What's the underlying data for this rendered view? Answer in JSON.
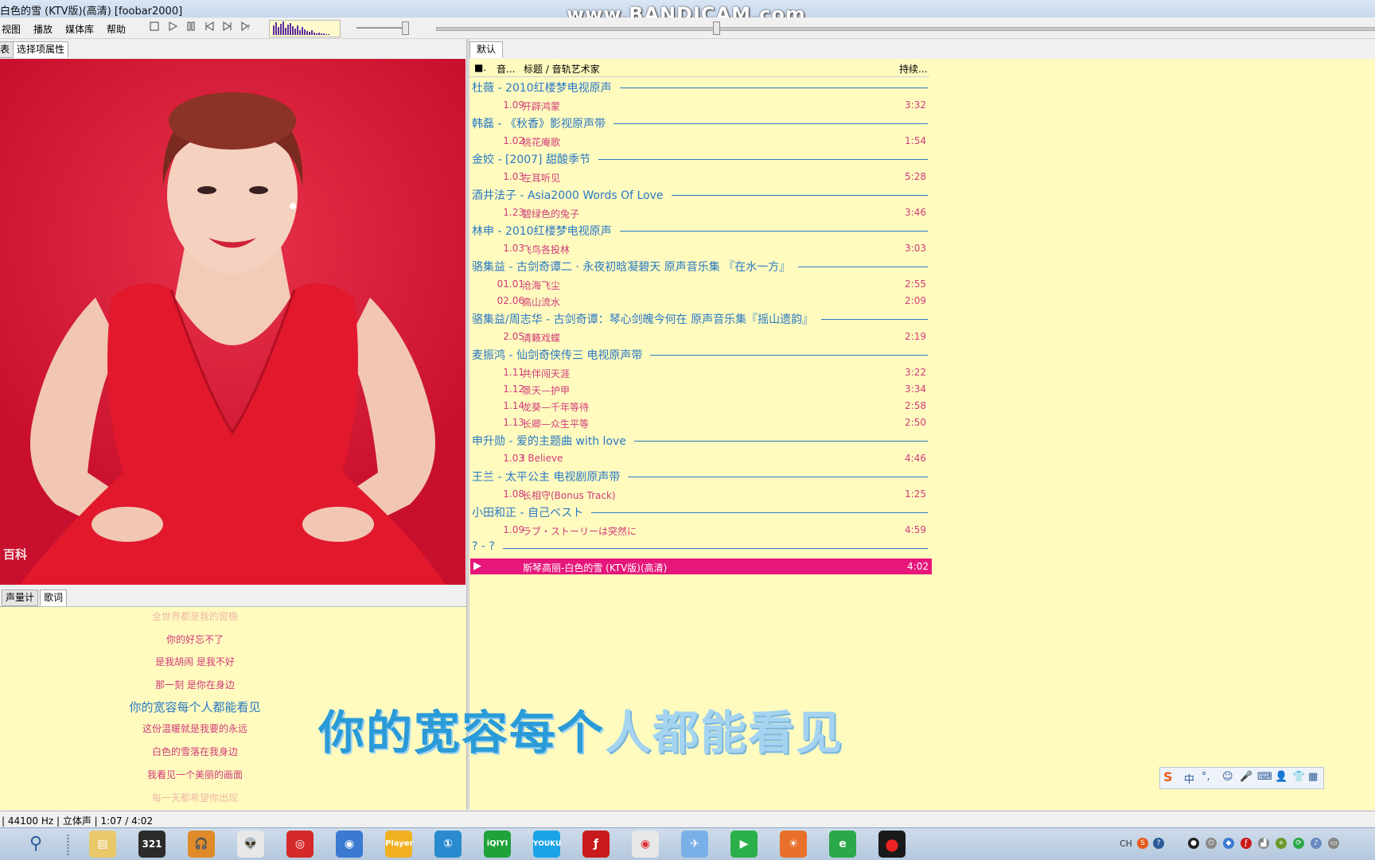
{
  "window": {
    "title": "白色的雪 (KTV版)(高清)  [foobar2000]",
    "watermark": "www.BANDICAM.com"
  },
  "menu": [
    "视图",
    "播放",
    "媒体库",
    "帮助"
  ],
  "toolbar": {
    "buttons": [
      "stop-icon",
      "play-icon",
      "pause-icon",
      "previous-icon",
      "next-icon",
      "random-icon"
    ]
  },
  "left_tabs": {
    "list": "表",
    "properties": "选择项属性"
  },
  "album_art": {
    "watermark": "百科"
  },
  "lyric_tabs": {
    "meter": "声量计",
    "lyrics": "歌词"
  },
  "lyrics": {
    "lines": [
      "全世界都是我的窗檐",
      "你的好忘不了",
      "是我胡闹 是我不好",
      "那一刻 是你在身边",
      "你的宽容每个人都能看见",
      "这份温暖就是我要的永远",
      "白色的雪落在我身边",
      "我看见一个美丽的画面",
      "每一天都希望你出现"
    ],
    "current_index": 4
  },
  "playlist": {
    "tab": "默认",
    "columns": {
      "c0": "■.",
      "c1": "音...",
      "c2": "标题 / 音轨艺术家",
      "c3": "持续..."
    },
    "groups": [
      {
        "header": "杜薇 - 2010红楼梦电视原声",
        "tracks": [
          {
            "no": "1.09",
            "title": "开辟鸿蒙",
            "dur": "3:32"
          }
        ]
      },
      {
        "header": "韩磊 - 《秋香》影视原声带",
        "tracks": [
          {
            "no": "1.02",
            "title": "桃花庵歌",
            "dur": "1:54"
          }
        ]
      },
      {
        "header": "金姣 - [2007] 甜酸季节",
        "tracks": [
          {
            "no": "1.03",
            "title": "左耳听见",
            "dur": "5:28"
          }
        ]
      },
      {
        "header": "酒井法子 - Asia2000 Words Of Love",
        "tracks": [
          {
            "no": "1.23",
            "title": "碧绿色的兔子",
            "dur": "3:46"
          }
        ]
      },
      {
        "header": "林申 - 2010红楼梦电视原声",
        "tracks": [
          {
            "no": "1.03",
            "title": "飞鸟各投林",
            "dur": "3:03"
          }
        ]
      },
      {
        "header": "骆集益 - 古剑奇谭二 · 永夜初晗凝碧天 原声音乐集 『在水一方』",
        "tracks": [
          {
            "no": "01.01",
            "title": "沧海飞尘",
            "dur": "2:55"
          },
          {
            "no": "02.06",
            "title": "高山流水",
            "dur": "2:09"
          }
        ]
      },
      {
        "header": "骆集益/周志华 - 古剑奇谭：琴心剑魄今何在 原声音乐集『摇山遗韵』",
        "tracks": [
          {
            "no": "2.05",
            "title": "清籁戏蝶",
            "dur": "2:19"
          }
        ]
      },
      {
        "header": "麦振鸿 - 仙剑奇侠传三 电视原声带",
        "tracks": [
          {
            "no": "1.11",
            "title": "共伴闯天涯",
            "dur": "3:22"
          },
          {
            "no": "1.12",
            "title": "景天—护甲",
            "dur": "3:34"
          },
          {
            "no": "1.14",
            "title": "龙葵—千年等待",
            "dur": "2:58"
          },
          {
            "no": "1.13",
            "title": "长卿—众生平等",
            "dur": "2:50"
          }
        ]
      },
      {
        "header": "申升勋 - 爱的主题曲 with love",
        "tracks": [
          {
            "no": "1.03",
            "title": "I Believe",
            "dur": "4:46"
          }
        ]
      },
      {
        "header": "王兰 - 太平公主 电视剧原声带",
        "tracks": [
          {
            "no": "1.08",
            "title": "长相守(Bonus Track)",
            "dur": "1:25"
          }
        ]
      },
      {
        "header": "小田和正 - 自己ベスト",
        "tracks": [
          {
            "no": "1.09",
            "title": "ラブ・ストーリーは突然に",
            "dur": "4:59"
          }
        ]
      },
      {
        "header": "? - ?",
        "tracks": []
      }
    ],
    "now_playing": {
      "title": "斯琴高丽-白色的雪 (KTV版)(高清)",
      "dur": "4:02"
    }
  },
  "subtitle": {
    "sung": "你的宽容每个",
    "unsung": "人都能看见"
  },
  "ime": {
    "logo": "S",
    "mode": "中",
    "punct": "°,"
  },
  "status": "| 44100 Hz | 立体声 | 1:07 / 4:02",
  "taskbar": {
    "apps": [
      "search-icon",
      "files-icon",
      "video-321-icon",
      "headphones-icon",
      "alien-icon",
      "netease-music-icon",
      "chrome-alt-icon",
      "player-icon",
      "one-icon",
      "iqiyi-icon",
      "youku-icon",
      "flash-icon",
      "chrome-icon",
      "bird-icon",
      "play-arrow-icon",
      "firefox-icon",
      "ie-icon",
      "record-icon"
    ],
    "labels": {
      "video": "321",
      "player": "Player",
      "iqiyi": "iQIYI",
      "youku": "YOUKU"
    },
    "tray_lang": "CH"
  },
  "colors": {
    "playlist_bg": "#fffbbf",
    "accent_blue": "#2a78c4",
    "track_pink": "#d13a7a",
    "now_playing": "#e6167a"
  }
}
